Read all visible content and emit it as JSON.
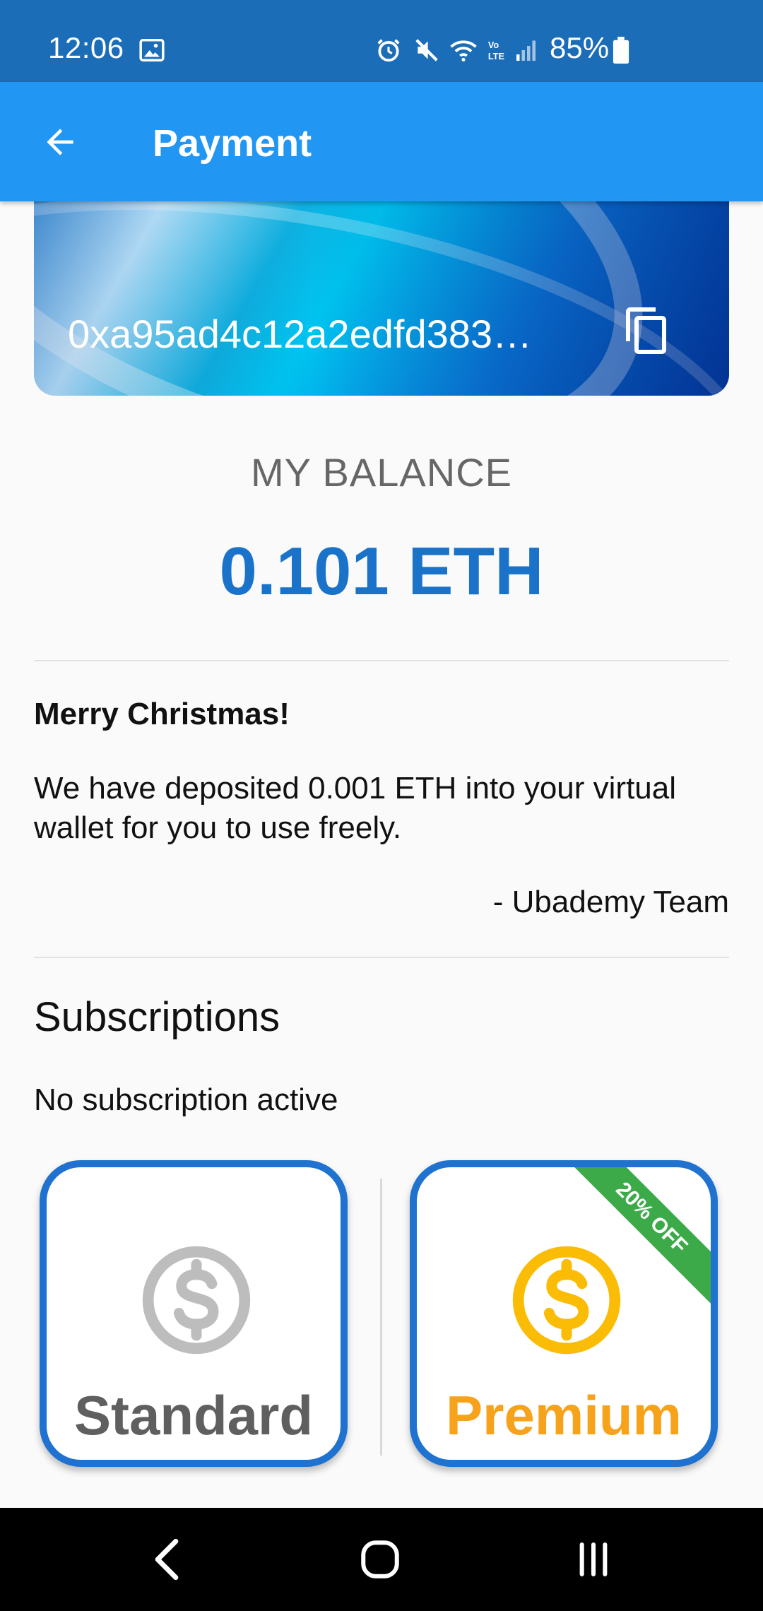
{
  "status_bar": {
    "time": "12:06",
    "battery": "85%",
    "icons": [
      "image-icon",
      "alarm-icon",
      "mute-icon",
      "wifi-icon",
      "volte-icon",
      "signal-icon",
      "battery-icon"
    ]
  },
  "app_bar": {
    "title": "Payment",
    "back_icon": "back-arrow-icon"
  },
  "wallet_card": {
    "address": "0xa95ad4c12a2edfd383…",
    "copy_icon": "copy-icon"
  },
  "balance": {
    "label": "MY BALANCE",
    "value": "0.101 ETH"
  },
  "message": {
    "title": "Merry Christmas!",
    "body": "We have deposited 0.001 ETH into your virtual wallet for you to use freely.",
    "signature": "- Ubademy Team"
  },
  "subscriptions": {
    "title": "Subscriptions",
    "status": "No subscription active",
    "plans": [
      {
        "label": "Standard",
        "icon": "dollar-icon",
        "color": "#bdbdbd"
      },
      {
        "label": "Premium",
        "icon": "dollar-icon",
        "color": "#fbbc05",
        "ribbon": "20% OFF"
      }
    ]
  },
  "colors": {
    "status_bar": "#1c6db8",
    "app_bar": "#2196f3",
    "accent": "#1a73c8",
    "ribbon": "#3daa4a",
    "premium": "#f7a21b"
  },
  "nav_bar": {
    "icons": [
      "nav-back-icon",
      "nav-home-icon",
      "nav-recents-icon"
    ]
  }
}
